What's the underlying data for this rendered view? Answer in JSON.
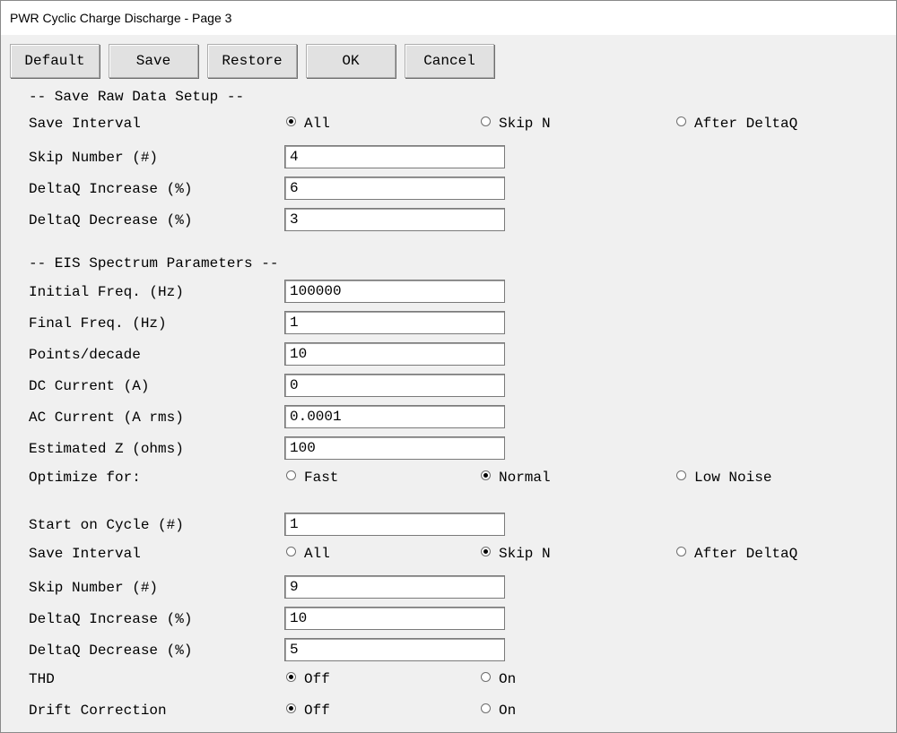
{
  "window": {
    "title": "PWR Cyclic Charge Discharge - Page 3"
  },
  "toolbar": {
    "default_label": "Default",
    "save_label": "Save",
    "restore_label": "Restore",
    "ok_label": "OK",
    "cancel_label": "Cancel"
  },
  "raw_data_setup": {
    "header": "-- Save Raw Data Setup --",
    "save_interval": {
      "label": "Save Interval",
      "options": [
        "All",
        "Skip N",
        "After DeltaQ"
      ],
      "selected": "All"
    },
    "skip_number": {
      "label": "Skip Number (#)",
      "value": "4"
    },
    "deltaq_increase": {
      "label": "DeltaQ Increase (%)",
      "value": "6"
    },
    "deltaq_decrease": {
      "label": "DeltaQ Decrease (%)",
      "value": "3"
    }
  },
  "eis_parameters": {
    "header": "-- EIS Spectrum Parameters --",
    "initial_freq": {
      "label": "Initial Freq. (Hz)",
      "value": "100000"
    },
    "final_freq": {
      "label": "Final Freq. (Hz)",
      "value": "1"
    },
    "points_decade": {
      "label": "Points/decade",
      "value": "10"
    },
    "dc_current": {
      "label": "DC Current (A)",
      "value": "0"
    },
    "ac_current": {
      "label": "AC Current (A rms)",
      "value": "0.0001"
    },
    "estimated_z": {
      "label": "Estimated Z (ohms)",
      "value": "100"
    },
    "optimize_for": {
      "label": "Optimize for:",
      "options": [
        "Fast",
        "Normal",
        "Low Noise"
      ],
      "selected": "Normal"
    }
  },
  "eis_save": {
    "start_on_cycle": {
      "label": "Start on Cycle (#)",
      "value": "1"
    },
    "save_interval": {
      "label": "Save Interval",
      "options": [
        "All",
        "Skip N",
        "After DeltaQ"
      ],
      "selected": "Skip N"
    },
    "skip_number": {
      "label": "Skip Number (#)",
      "value": "9"
    },
    "deltaq_increase": {
      "label": "DeltaQ Increase (%)",
      "value": "10"
    },
    "deltaq_decrease": {
      "label": "DeltaQ Decrease (%)",
      "value": "5"
    },
    "thd": {
      "label": "THD",
      "options": [
        "Off",
        "On"
      ],
      "selected": "Off"
    },
    "drift_correction": {
      "label": "Drift Correction",
      "options": [
        "Off",
        "On"
      ],
      "selected": "Off"
    }
  }
}
